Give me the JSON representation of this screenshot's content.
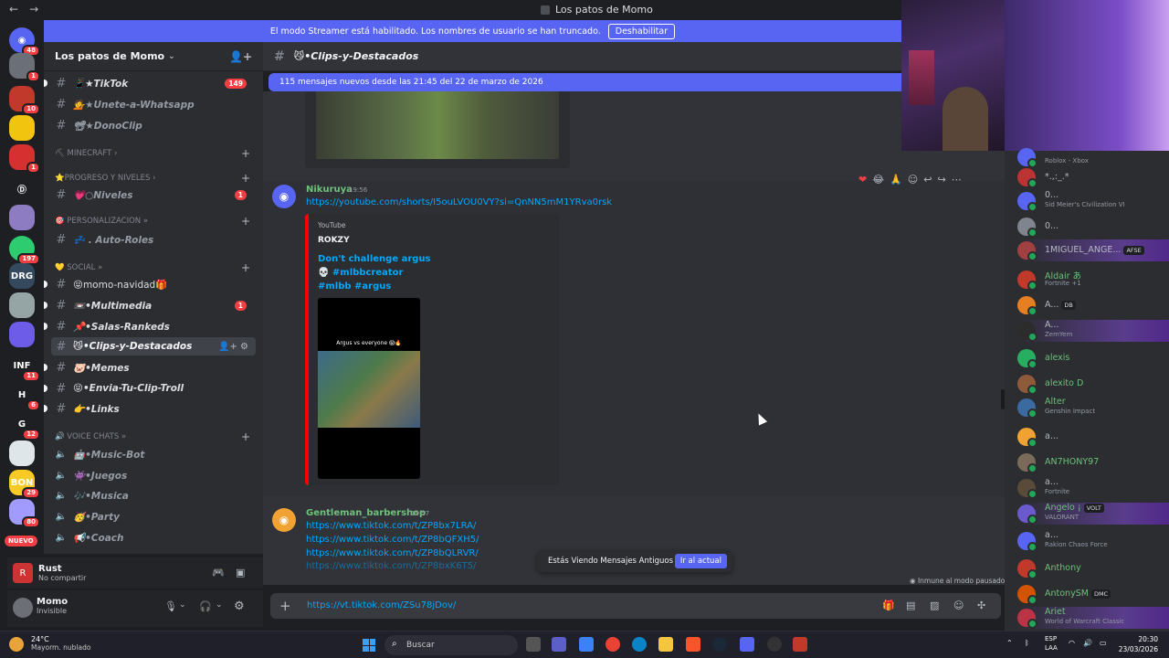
{
  "window": {
    "title": "Los patos de Momo",
    "back_icon": "arrow-left-icon",
    "forward_icon": "arrow-right-icon"
  },
  "streamer_banner": {
    "text": "El modo Streamer está habilitado. Los nombres de usuario se han truncado.",
    "button": "Deshabilitar"
  },
  "servers": [
    {
      "name": "discord-home",
      "badge": "48",
      "color": "#5865f2",
      "glyph": "◉"
    },
    {
      "name": "server-2",
      "badge": "1",
      "color": "#6b6f77",
      "glyph": ""
    },
    {
      "name": "server-3",
      "badge": "10",
      "color": "#c0392b",
      "glyph": ""
    },
    {
      "name": "server-4",
      "badge": "",
      "color": "#f1c40f",
      "glyph": ""
    },
    {
      "name": "server-5",
      "badge": "1",
      "color": "#d63031",
      "glyph": ""
    },
    {
      "name": "server-6",
      "badge": "",
      "color": "#1e1f22",
      "glyph": "Ⓓ"
    },
    {
      "name": "server-7",
      "badge": "",
      "color": "#8e7cc3",
      "glyph": ""
    },
    {
      "name": "server-8",
      "badge": "197",
      "color": "#2ecc71",
      "glyph": ""
    },
    {
      "name": "server-9",
      "badge": "",
      "color": "#34495e",
      "glyph": "DRG"
    },
    {
      "name": "server-10",
      "badge": "",
      "color": "#95a5a6",
      "glyph": ""
    },
    {
      "name": "server-11",
      "badge": "",
      "color": "#6c5ce7",
      "glyph": ""
    },
    {
      "name": "server-12",
      "badge": "11",
      "color": "#1e1f22",
      "glyph": "INF"
    },
    {
      "name": "server-13",
      "badge": "6",
      "color": "#1e1f22",
      "glyph": "H"
    },
    {
      "name": "server-14",
      "badge": "12",
      "color": "#1e1f22",
      "glyph": "G"
    },
    {
      "name": "server-15",
      "badge": "",
      "color": "#dfe6e9",
      "glyph": ""
    },
    {
      "name": "server-16",
      "badge": "29",
      "color": "#f9ca24",
      "glyph": "BON"
    },
    {
      "name": "server-17",
      "badge": "80",
      "color": "#a29bfe",
      "glyph": ""
    }
  ],
  "nuevo_label": "NUEVO",
  "guild": {
    "name": "Los patos de Momo",
    "chevron": "chevron-down-icon",
    "invite_icon": "add-member-icon"
  },
  "channels": [
    {
      "type": "text",
      "label": "📱★TikTok",
      "badge": "149",
      "unread": true,
      "italic": true
    },
    {
      "type": "text",
      "label": "💁★Unete-a-Whatsapp",
      "badge": "",
      "unread": false,
      "italic": true
    },
    {
      "type": "text",
      "label": "📽★DonoClip",
      "badge": "",
      "unread": false,
      "italic": true
    },
    {
      "type": "category",
      "label": "⛏ MINECRAFT ›"
    },
    {
      "type": "category",
      "label": "⭐PROGRESO Y NIVELES ›"
    },
    {
      "type": "text",
      "label": "💗○Niveles",
      "badge": "1",
      "unread": false,
      "italic": true
    },
    {
      "type": "category",
      "label": "🎯 PERSONALIZACION »"
    },
    {
      "type": "text",
      "label": "💤 . Auto-Roles",
      "badge": "",
      "unread": false,
      "italic": true
    },
    {
      "type": "category",
      "label": "💛 SOCIAL »"
    },
    {
      "type": "text",
      "label": "😝momo-navidad🎁",
      "badge": "",
      "unread": true,
      "italic": false
    },
    {
      "type": "text",
      "label": "📼•Multimedia",
      "badge": "1",
      "unread": true,
      "italic": true
    },
    {
      "type": "text",
      "label": "📌•Salas-Rankeds",
      "badge": "",
      "unread": true,
      "italic": true
    },
    {
      "type": "text",
      "label": "😼•Clips-y-Destacados",
      "badge": "",
      "unread": false,
      "italic": true,
      "active": true
    },
    {
      "type": "text",
      "label": "🐷•Memes",
      "badge": "",
      "unread": true,
      "italic": true
    },
    {
      "type": "text",
      "label": "😝•Envia-Tu-Clip-Troll",
      "badge": "",
      "unread": true,
      "italic": true
    },
    {
      "type": "text",
      "label": "👉•Links",
      "badge": "",
      "unread": true,
      "italic": true
    },
    {
      "type": "category",
      "label": "🔊 VOICE CHATS »"
    },
    {
      "type": "voice",
      "label": "🤖•Music-Bot"
    },
    {
      "type": "voice",
      "label": "👾•Juegos"
    },
    {
      "type": "voice",
      "label": "🎶•Musica"
    },
    {
      "type": "voice",
      "label": "🥳•Party"
    },
    {
      "type": "voice",
      "label": "📢•Coach"
    }
  ],
  "activity_panel": {
    "title": "Rust",
    "subtitle": "No compartir"
  },
  "user_panel": {
    "name": "Momo",
    "status": "Invisible"
  },
  "chat": {
    "channel_name": "😼•Clips-y-Destacados",
    "new_messages": "115 mensajes nuevos desde las 21:45 del 22 de marzo de 2026",
    "messages": [
      {
        "author": "Nikuruya",
        "time": "19:56",
        "link": "https://youtube.com/shorts/I5ouLVOU0VY?si=QnNN5mM1YRva0rsk",
        "embed": {
          "provider": "YouTube",
          "author": "ROKZY",
          "title_lines": [
            "Don't challenge argus",
            "💀 #mlbbcreator",
            "#mlbb #argus"
          ],
          "video_caption": "Argus vs everyone 😱🔥"
        }
      },
      {
        "author": "Gentleman_barbershop",
        "time": "19:57",
        "links": [
          "https://www.tiktok.com/t/ZP8bx7LRA/",
          "https://www.tiktok.com/t/ZP8bQFXH5/",
          "https://www.tiktok.com/t/ZP8bQLRVR/",
          "https://www.tiktok.com/t/ZP8bxK6T5/"
        ]
      }
    ],
    "reactions": [
      "❤",
      "😂",
      "🙏"
    ],
    "toast": {
      "text": "Estás Viendo Mensajes Antiguos",
      "button": "Ir al actual"
    },
    "immune_text": "Inmune al modo pausado",
    "input_value": "https://vt.tiktok.com/ZSu78jDov/"
  },
  "members": [
    {
      "name": "",
      "status": "Roblox - Xbox",
      "color": "#5865f2",
      "green": false
    },
    {
      "name": "*.,:_.*",
      "status": "",
      "color": "#b33",
      "green": false
    },
    {
      "name": "0...",
      "status": "Sid Meier's Civilization VI",
      "color": "#5865f2",
      "green": false
    },
    {
      "name": "0...",
      "status": "",
      "color": "#80848e",
      "green": false
    },
    {
      "name": "1MIGUEL_ANGE...",
      "status": "",
      "tag": "AFSE",
      "color": "#a04040",
      "green": false,
      "boost": true
    },
    {
      "name": "Aldair あ",
      "status": "Fortnite +1",
      "color": "#c0392b",
      "green": true
    },
    {
      "name": "A...",
      "status": "",
      "tag": "DB",
      "color": "#e67e22",
      "green": false
    },
    {
      "name": "A...",
      "status": "ZemYem",
      "color": "#2c2c2c",
      "green": false,
      "boost": true
    },
    {
      "name": "alexis",
      "status": "",
      "color": "#27ae60",
      "green": true
    },
    {
      "name": "alexito D",
      "status": "",
      "color": "#8e5a3a",
      "green": true
    },
    {
      "name": "Alter",
      "status": "Genshin Impact",
      "color": "#3a6aa0",
      "green": true
    },
    {
      "name": "a...",
      "status": "",
      "color": "#f0a232",
      "green": false
    },
    {
      "name": "AN7HONY97",
      "status": "",
      "color": "#7a6a5a",
      "green": true
    },
    {
      "name": "a...",
      "status": "Fortnite",
      "color": "#5a4a3a",
      "green": false
    },
    {
      "name": "Angelo ¡",
      "status": "VALORANT",
      "tag": "VOLT",
      "color": "#6a5acd",
      "green": true,
      "boost": true
    },
    {
      "name": "a...",
      "status": "Rakion Chaos Force",
      "color": "#5865f2",
      "green": false
    },
    {
      "name": "Anthony",
      "status": "",
      "color": "#c0392b",
      "green": true
    },
    {
      "name": "AntonySM",
      "status": "",
      "tag": "DMC",
      "color": "#d35400",
      "green": true
    },
    {
      "name": "Ariet",
      "status": "World of Warcraft Classic",
      "color": "#b34",
      "green": true,
      "boost": true
    }
  ],
  "taskbar": {
    "weather_temp": "24°C",
    "weather_desc": "Mayorm. nublado",
    "search_placeholder": "Buscar",
    "lang_line1": "ESP",
    "lang_line2": "LAA",
    "time": "20:30",
    "date": "23/03/2026"
  }
}
